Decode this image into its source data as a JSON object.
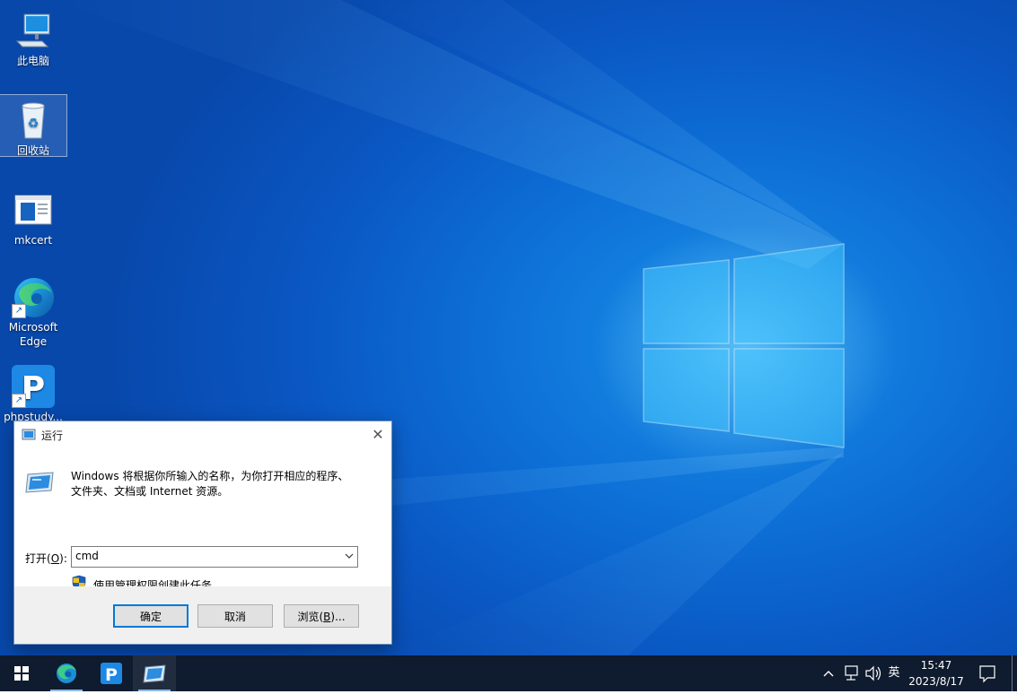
{
  "desktop": {
    "icons": [
      {
        "label": "此电脑",
        "icon": "computer-icon"
      },
      {
        "label": "回收站",
        "icon": "recycle-bin-icon"
      },
      {
        "label": "mkcert",
        "icon": "app-window-icon"
      },
      {
        "label_line1": "Microsoft",
        "label_line2": "Edge",
        "icon": "edge-icon"
      },
      {
        "label": "phpstudy...",
        "icon": "phpstudy-icon"
      }
    ]
  },
  "run_dialog": {
    "title": "运行",
    "description_line1": "Windows 将根据你所输入的名称，为你打开相应的程序、",
    "description_line2": "文件夹、文档或 Internet 资源。",
    "open_label_prefix": "打开(",
    "open_label_key": "O",
    "open_label_suffix": "):",
    "input_value": "cmd",
    "admin_note": "使用管理权限创建此任务。",
    "ok_label": "确定",
    "cancel_label": "取消",
    "browse_label_prefix": "浏览(",
    "browse_label_key": "B",
    "browse_label_suffix": ")..."
  },
  "taskbar": {
    "pinned": [
      "edge-icon",
      "phpstudy-icon",
      "run-icon"
    ],
    "tray_lang": "英",
    "time": "15:47",
    "date": "2023/8/17"
  },
  "colors": {
    "accent": "#0078d7",
    "taskbar": "#0f1b2e"
  }
}
